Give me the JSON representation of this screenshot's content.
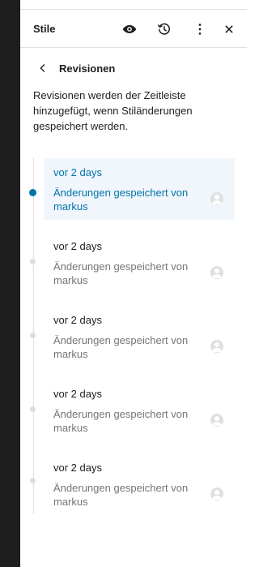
{
  "header": {
    "title": "Stile",
    "icons": [
      "eye-icon",
      "history-icon",
      "more-vertical-icon",
      "close-icon"
    ]
  },
  "nav": {
    "back_icon": "chevron-left-icon",
    "title": "Revisionen"
  },
  "description": "Revisionen werden der Zeitleiste hinzugefügt, wenn Stiländerungen gespeichert werden.",
  "revisions": [
    {
      "time": "vor 2 days",
      "message": "Änderungen gespeichert von markus",
      "active": true
    },
    {
      "time": "vor 2 days",
      "message": "Änderungen gespeichert von markus",
      "active": false
    },
    {
      "time": "vor 2 days",
      "message": "Änderungen gespeichert von markus",
      "active": false
    },
    {
      "time": "vor 2 days",
      "message": "Änderungen gespeichert von markus",
      "active": false
    },
    {
      "time": "vor 2 days",
      "message": "Änderungen gespeichert von markus",
      "active": false
    }
  ],
  "colors": {
    "accent": "#0073aa",
    "active_bg": "#f0f6fc",
    "editor_dark": "#1e1e1e"
  }
}
